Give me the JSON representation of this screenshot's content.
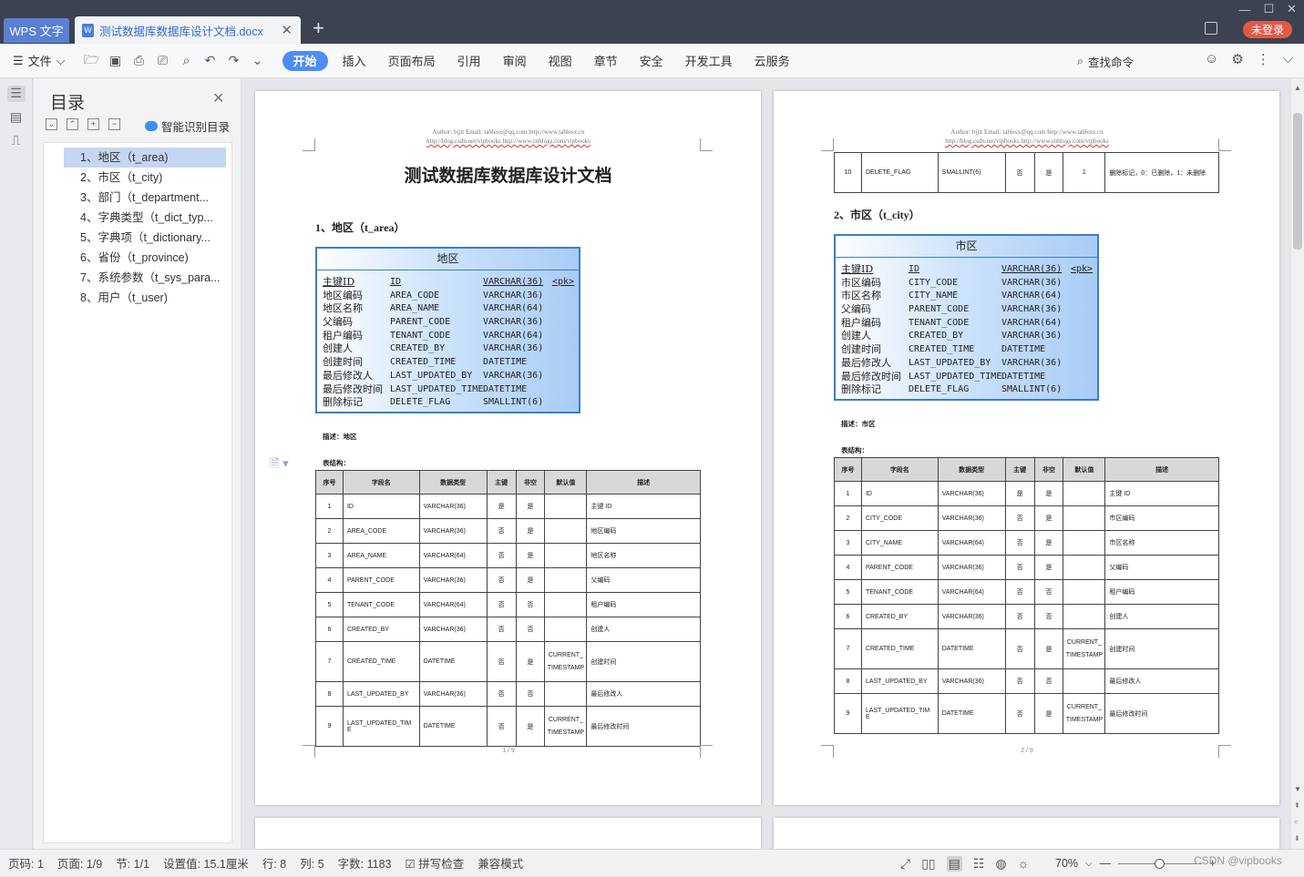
{
  "titlebar": {
    "app_tab": "WPS 文字",
    "doc_name": "测试数据库数据库设计文档.docx",
    "login": "未登录"
  },
  "toolbar": {
    "file": "文件",
    "tabs": [
      "开始",
      "插入",
      "页面布局",
      "引用",
      "审阅",
      "视图",
      "章节",
      "安全",
      "开发工具",
      "云服务"
    ],
    "search": "查找命令"
  },
  "toc": {
    "title": "目录",
    "smart": "智能识别目录",
    "items": [
      "1、地区（t_area)",
      "2、市区（t_city)",
      "3、部门（t_department...",
      "4、字典类型（t_dict_typ...",
      "5、字典项（t_dictionary...",
      "6、省份（t_province)",
      "7、系统参数（t_sys_para...",
      "8、用户（t_user)"
    ]
  },
  "page1": {
    "header1": "Author: bjjtt    Email: tablesx@qq.com    http://www.tablesx.cn",
    "header2": "http://blog.csdn.net/vipbooks    http://www.cnblogs.com/vipbooks",
    "title": "测试数据库数据库设计文档",
    "section": "1、地区（t_area）",
    "entity": {
      "name": "地区",
      "rows": [
        [
          "主键ID",
          "ID",
          "VARCHAR(36)",
          "<pk>"
        ],
        [
          "地区编码",
          "AREA_CODE",
          "VARCHAR(36)",
          ""
        ],
        [
          "地区名称",
          "AREA_NAME",
          "VARCHAR(64)",
          ""
        ],
        [
          "父编码",
          "PARENT_CODE",
          "VARCHAR(36)",
          ""
        ],
        [
          "租户编码",
          "TENANT_CODE",
          "VARCHAR(64)",
          ""
        ],
        [
          "创建人",
          "CREATED_BY",
          "VARCHAR(36)",
          ""
        ],
        [
          "创建时间",
          "CREATED_TIME",
          "DATETIME",
          ""
        ],
        [
          "最后修改人",
          "LAST_UPDATED_BY",
          "VARCHAR(36)",
          ""
        ],
        [
          "最后修改时间",
          "LAST_UPDATED_TIME",
          "DATETIME",
          ""
        ],
        [
          "删除标记",
          "DELETE_FLAG",
          "SMALLINT(6)",
          ""
        ]
      ]
    },
    "desc": "描述：地区",
    "struct": "表结构：",
    "headers": [
      "序号",
      "字段名",
      "数据类型",
      "主键",
      "非空",
      "默认值",
      "描述"
    ],
    "rows": [
      [
        "1",
        "ID",
        "VARCHAR(36)",
        "是",
        "是",
        "",
        "主键 ID"
      ],
      [
        "2",
        "AREA_CODE",
        "VARCHAR(36)",
        "否",
        "是",
        "",
        "地区编码"
      ],
      [
        "3",
        "AREA_NAME",
        "VARCHAR(64)",
        "否",
        "是",
        "",
        "地区名称"
      ],
      [
        "4",
        "PARENT_CODE",
        "VARCHAR(36)",
        "否",
        "是",
        "",
        "父编码"
      ],
      [
        "5",
        "TENANT_CODE",
        "VARCHAR(64)",
        "否",
        "否",
        "",
        "租户编码"
      ],
      [
        "6",
        "CREATED_BY",
        "VARCHAR(36)",
        "否",
        "否",
        "",
        "创建人"
      ],
      [
        "7",
        "CREATED_TIME",
        "DATETIME",
        "否",
        "是",
        "CURRENT_TIMESTAMP",
        "创建时间"
      ],
      [
        "8",
        "LAST_UPDATED_BY",
        "VARCHAR(36)",
        "否",
        "否",
        "",
        "最后修改人"
      ],
      [
        "9",
        "LAST_UPDATED_TIME",
        "DATETIME",
        "否",
        "是",
        "CURRENT_TIMESTAMP",
        "最后修改时间"
      ]
    ],
    "page_num": "1 / 9"
  },
  "page2": {
    "header1": "Author: bjjtt    Email: tablesx@qq.com    http://www.tablesx.cn",
    "header2": "http://blog.csdn.net/vipbooks    http://www.cnblogs.com/vipbooks",
    "top_row": [
      "10",
      "DELETE_FLAG",
      "SMALLINT(6)",
      "否",
      "是",
      "1",
      "删除标记，0：已删除，1：未删除"
    ],
    "section": "2、市区（t_city）",
    "entity": {
      "name": "市区",
      "rows": [
        [
          "主键ID",
          "ID",
          "VARCHAR(36)",
          "<pk>"
        ],
        [
          "市区编码",
          "CITY_CODE",
          "VARCHAR(36)",
          ""
        ],
        [
          "市区名称",
          "CITY_NAME",
          "VARCHAR(64)",
          ""
        ],
        [
          "父编码",
          "PARENT_CODE",
          "VARCHAR(36)",
          ""
        ],
        [
          "租户编码",
          "TENANT_CODE",
          "VARCHAR(64)",
          ""
        ],
        [
          "创建人",
          "CREATED_BY",
          "VARCHAR(36)",
          ""
        ],
        [
          "创建时间",
          "CREATED_TIME",
          "DATETIME",
          ""
        ],
        [
          "最后修改人",
          "LAST_UPDATED_BY",
          "VARCHAR(36)",
          ""
        ],
        [
          "最后修改时间",
          "LAST_UPDATED_TIME",
          "DATETIME",
          ""
        ],
        [
          "删除标记",
          "DELETE_FLAG",
          "SMALLINT(6)",
          ""
        ]
      ]
    },
    "desc": "描述：市区",
    "struct": "表结构：",
    "headers": [
      "序号",
      "字段名",
      "数据类型",
      "主键",
      "非空",
      "默认值",
      "描述"
    ],
    "rows": [
      [
        "1",
        "ID",
        "VARCHAR(36)",
        "是",
        "是",
        "",
        "主键 ID"
      ],
      [
        "2",
        "CITY_CODE",
        "VARCHAR(36)",
        "否",
        "是",
        "",
        "市区编码"
      ],
      [
        "3",
        "CITY_NAME",
        "VARCHAR(64)",
        "否",
        "是",
        "",
        "市区名称"
      ],
      [
        "4",
        "PARENT_CODE",
        "VARCHAR(36)",
        "否",
        "是",
        "",
        "父编码"
      ],
      [
        "5",
        "TENANT_CODE",
        "VARCHAR(64)",
        "否",
        "否",
        "",
        "租户编码"
      ],
      [
        "6",
        "CREATED_BY",
        "VARCHAR(36)",
        "否",
        "否",
        "",
        "创建人"
      ],
      [
        "7",
        "CREATED_TIME",
        "DATETIME",
        "否",
        "是",
        "CURRENT_TIMESTAMP",
        "创建时间"
      ],
      [
        "8",
        "LAST_UPDATED_BY",
        "VARCHAR(36)",
        "否",
        "否",
        "",
        "最后修改人"
      ],
      [
        "9",
        "LAST_UPDATED_TIME",
        "DATETIME",
        "否",
        "是",
        "CURRENT_TIMESTAMP",
        "最后修改时间"
      ]
    ],
    "page_num": "2 / 9"
  },
  "status": {
    "page_code": "页码: 1",
    "pages": "页面: 1/9",
    "section": "节: 1/1",
    "setting": "设置值: 15.1厘米",
    "row": "行: 8",
    "col": "列: 5",
    "words": "字数: 1183",
    "spell": "拼写检查",
    "compat": "兼容模式",
    "zoom": "70%"
  },
  "watermark": "CSDN @vipbooks"
}
